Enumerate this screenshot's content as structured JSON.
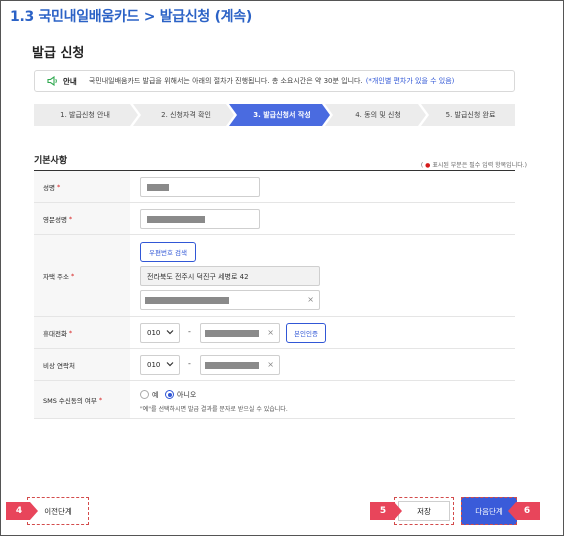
{
  "top_title": "1.3 국민내일배움카드 > 발급신청 (계속)",
  "page_title": "발급 신청",
  "notice": {
    "label": "안내",
    "text": "국민내일배움카드 발급을 위해서는 아래의 절차가 진행됩니다. 총 소요시간은 약 30분 입니다.",
    "link": "(*개인별 편차가 있을 수 있음)",
    "icon": "speaker-icon"
  },
  "steps": [
    {
      "label": "1. 발급신청 안내",
      "active": false
    },
    {
      "label": "2. 신청자격 확인",
      "active": false
    },
    {
      "label": "3. 발급신청서 작성",
      "active": true
    },
    {
      "label": "4. 동의 및 신청",
      "active": false
    },
    {
      "label": "5. 발급신청 완료",
      "active": false
    }
  ],
  "section": {
    "title": "기본사항",
    "required_note_open": "( ",
    "required_note_dot": "●",
    "required_note_text": " 표시된 부분은 필수 입력 항목입니다.)"
  },
  "fields": {
    "name_label": "성명",
    "eng_name_label": "영문성명",
    "address_label": "자택 주소",
    "address_search_button": "우편번호 검색",
    "address_line1": "전라북도 전주시 덕진구 세병로 42",
    "mobile_label": "휴대전화",
    "mobile_prefix": "010",
    "mobile_dash": "-",
    "verify_button": "본인인증",
    "emergency_label": "비상 연락처",
    "emergency_prefix": "010",
    "emergency_dash": "-",
    "sms_label": "SMS 수신동의 여부",
    "sms_yes": "예",
    "sms_no": "아니오",
    "sms_selected": "아니오",
    "sms_hint": "\"예\"를 선택하시면 발급 결과를 문자로 받으실 수 있습니다.",
    "required_star": "*",
    "clear_symbol": "×"
  },
  "buttons": {
    "prev": "이전단계",
    "save": "저장",
    "next": "다음단계"
  },
  "badges": {
    "prev": "4",
    "save": "5",
    "next": "6"
  },
  "colors": {
    "accent": "#3157d6",
    "title_blue": "#2b62c6",
    "required_red": "#d51b1b",
    "badge_red": "#e8455b",
    "step_active": "#4a6be0",
    "step_inactive": "#ececec",
    "next_button": "#3a5bd9"
  }
}
